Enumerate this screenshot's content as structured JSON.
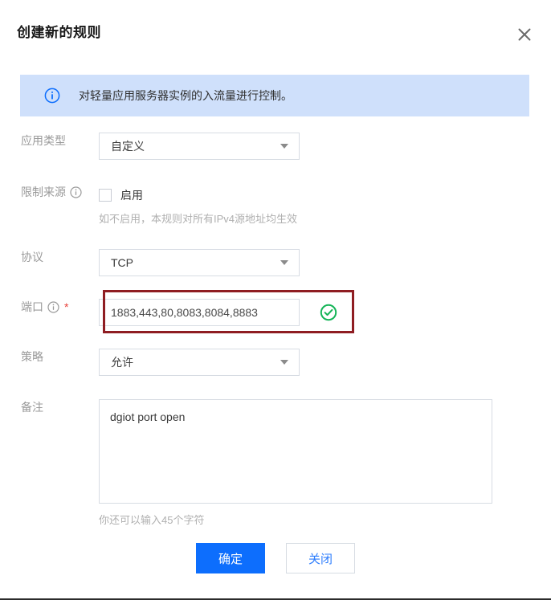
{
  "dialog": {
    "title": "创建新的规则",
    "close_icon": "close-icon"
  },
  "banner": {
    "icon": "info-circle-icon",
    "text": "对轻量应用服务器实例的入流量进行控制。"
  },
  "form": {
    "app_type": {
      "label": "应用类型",
      "value": "自定义",
      "caret": "chevron-down-icon"
    },
    "limit_source": {
      "label": "限制来源",
      "info_icon": "info-circle-icon",
      "checkbox_label": "启用",
      "checked": false,
      "hint": "如不启用，本规则对所有IPv4源地址均生效"
    },
    "protocol": {
      "label": "协议",
      "value": "TCP",
      "caret": "chevron-down-icon"
    },
    "port": {
      "label": "端口",
      "info_icon": "info-circle-icon",
      "required_mark": "*",
      "value": "1883,443,80,8083,8084,8883",
      "valid_icon": "check-circle-icon",
      "highlight_color": "#8f1d22"
    },
    "policy": {
      "label": "策略",
      "value": "允许",
      "caret": "chevron-down-icon"
    },
    "remark": {
      "label": "备注",
      "value": "dgiot port open",
      "counter": "你还可以输入45个字符"
    }
  },
  "footer": {
    "confirm_label": "确定",
    "close_label": "关闭"
  },
  "colors": {
    "primary": "#0d6efd",
    "banner_bg": "#cfe0fb",
    "success": "#14b457",
    "danger": "#8f1d22",
    "required": "#e8403a"
  }
}
